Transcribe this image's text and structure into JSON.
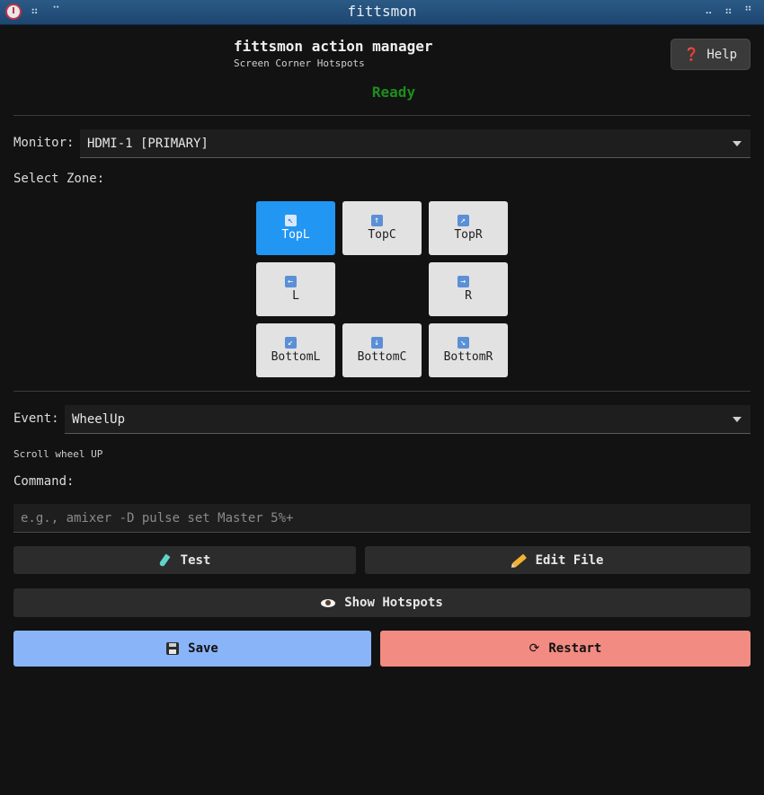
{
  "window": {
    "title": "fittsmon"
  },
  "header": {
    "title": "fittsmon action manager",
    "subtitle": "Screen Corner Hotspots",
    "help_label": "Help",
    "help_icon": "❓"
  },
  "status": {
    "text": "Ready",
    "color": "#1e8c1e"
  },
  "monitor": {
    "label": "Monitor:",
    "selected": "HDMI-1 [PRIMARY]"
  },
  "zone_section": {
    "label": "Select Zone:"
  },
  "zones": [
    {
      "id": "TopL",
      "label": "TopL",
      "arrow": "↖",
      "active": true
    },
    {
      "id": "TopC",
      "label": "TopC",
      "arrow": "↑",
      "active": false
    },
    {
      "id": "TopR",
      "label": "TopR",
      "arrow": "↗",
      "active": false
    },
    {
      "id": "L",
      "label": "L",
      "arrow": "←",
      "active": false
    },
    {
      "id": "R",
      "label": "R",
      "arrow": "→",
      "active": false
    },
    {
      "id": "BottomL",
      "label": "BottomL",
      "arrow": "↙",
      "active": false
    },
    {
      "id": "BottomC",
      "label": "BottomC",
      "arrow": "↓",
      "active": false
    },
    {
      "id": "BottomR",
      "label": "BottomR",
      "arrow": "↘",
      "active": false
    }
  ],
  "event": {
    "label": "Event:",
    "selected": "WheelUp",
    "description": "Scroll wheel UP"
  },
  "command": {
    "label": "Command:",
    "value": "",
    "placeholder": "e.g., amixer -D pulse set Master 5%+"
  },
  "actions": {
    "test_label": "Test",
    "edit_label": "Edit File",
    "show_hotspots_label": "Show Hotspots",
    "save_label": "Save",
    "restart_label": "Restart",
    "restart_icon": "⟳"
  },
  "colors": {
    "accent": "#2196f3",
    "save": "#8ab4f8",
    "restart": "#f28b82",
    "background": "#121212"
  }
}
